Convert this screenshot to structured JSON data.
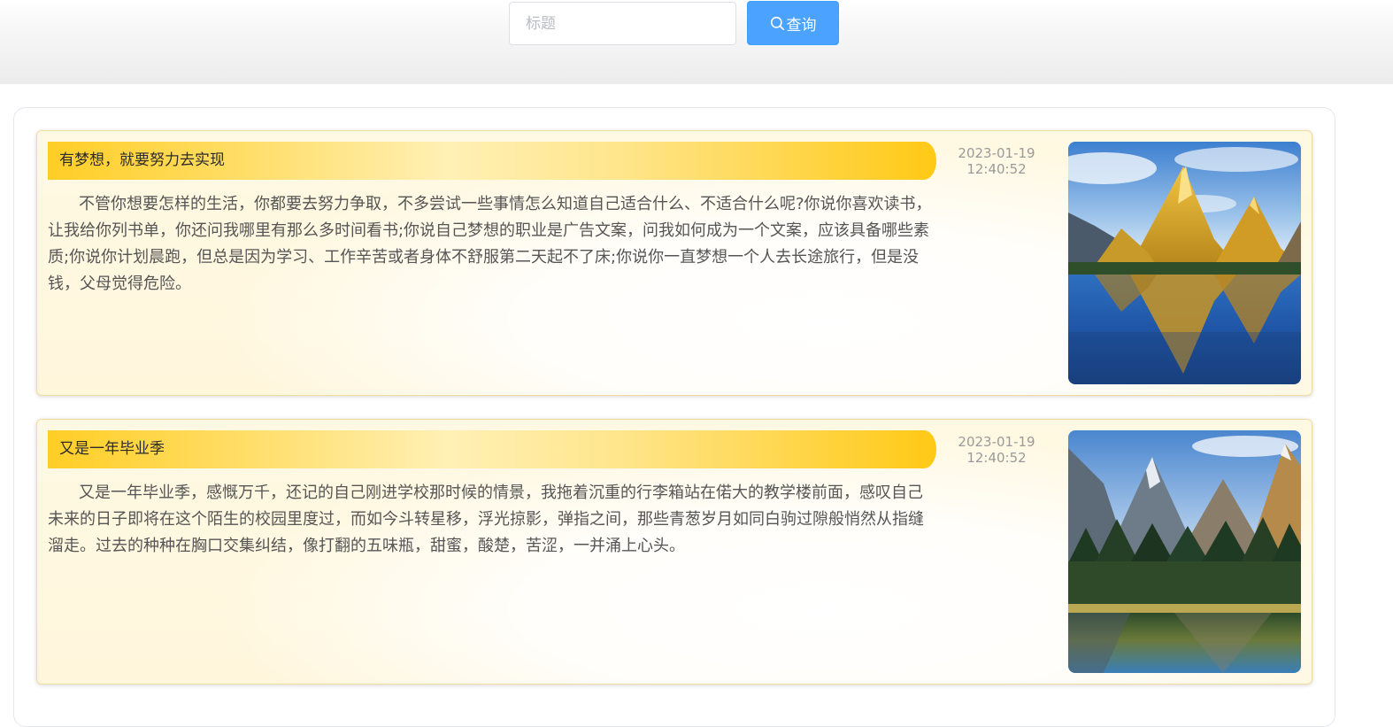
{
  "search": {
    "placeholder": "标题",
    "button_label": "查询",
    "button_icon": "search-icon",
    "button_color": "#409eff"
  },
  "articles": [
    {
      "title": "有梦想，就要努力去实现",
      "content": "不管你想要怎样的生活，你都要去努力争取，不多尝试一些事情怎么知道自己适合什么、不适合什么呢?你说你喜欢读书，让我给你列书单，你还问我哪里有那么多时间看书;你说自己梦想的职业是广告文案，问我如何成为一个文案，应该具备哪些素质;你说你计划晨跑，但总是因为学习、工作辛苦或者身体不舒服第二天起不了床;你说你一直梦想一个人去长途旅行，但是没钱，父母觉得危险。",
      "date": "2023-01-19",
      "time": "12:40:52",
      "image": "golden mountain reflected in a blue lake"
    },
    {
      "title": "又是一年毕业季",
      "content": "又是一年毕业季，感慨万千，还记的自己刚进学校那时候的情景，我拖着沉重的行李箱站在偌大的教学楼前面，感叹自己未来的日子即将在这个陌生的校园里度过，而如今斗转星移，浮光掠影，弹指之间，那些青葱岁月如同白驹过隙般悄然从指缝溜走。过去的种种在胸口交集纠结，像打翻的五味瓶，甜蜜，酸楚，苦涩，一并涌上心头。",
      "date": "2023-01-19",
      "time": "12:40:52",
      "image": "mountain lake with pine forest and reflection"
    }
  ]
}
